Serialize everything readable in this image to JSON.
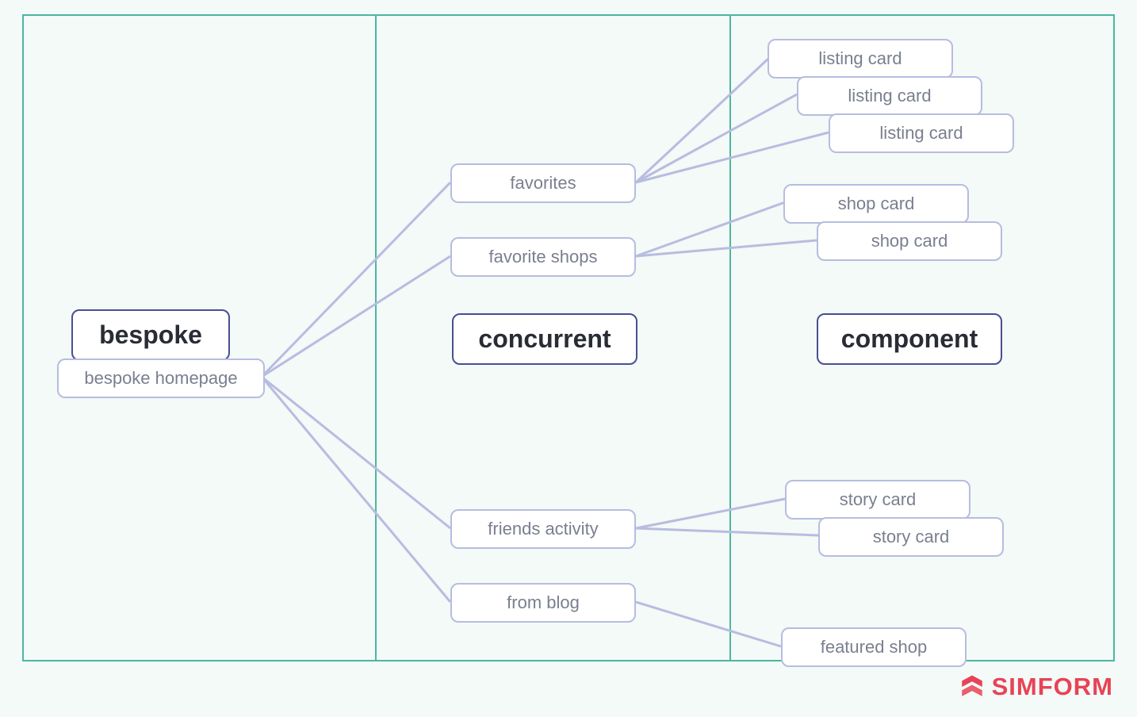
{
  "columns": {
    "bespoke": {
      "header": "bespoke",
      "nodes": {
        "homepage": "bespoke homepage"
      }
    },
    "concurrent": {
      "header": "concurrent",
      "nodes": {
        "favorites": "favorites",
        "favorite_shops": "favorite shops",
        "friends_activity": "friends activity",
        "from_blog": "from blog"
      }
    },
    "component": {
      "header": "component",
      "nodes": {
        "listing_card_1": "listing card",
        "listing_card_2": "listing card",
        "listing_card_3": "listing card",
        "shop_card_1": "shop card",
        "shop_card_2": "shop card",
        "story_card_1": "story card",
        "story_card_2": "story card",
        "featured_shop": "featured shop"
      }
    }
  },
  "logo": {
    "text": "SIMFORM"
  },
  "colors": {
    "border_teal": "#4db6a1",
    "box_purple": "#b8bce0",
    "header_purple": "#4a4e92",
    "text_gray": "#7a7f8f",
    "logo_red": "#e84356",
    "bg": "#f3faf7"
  }
}
